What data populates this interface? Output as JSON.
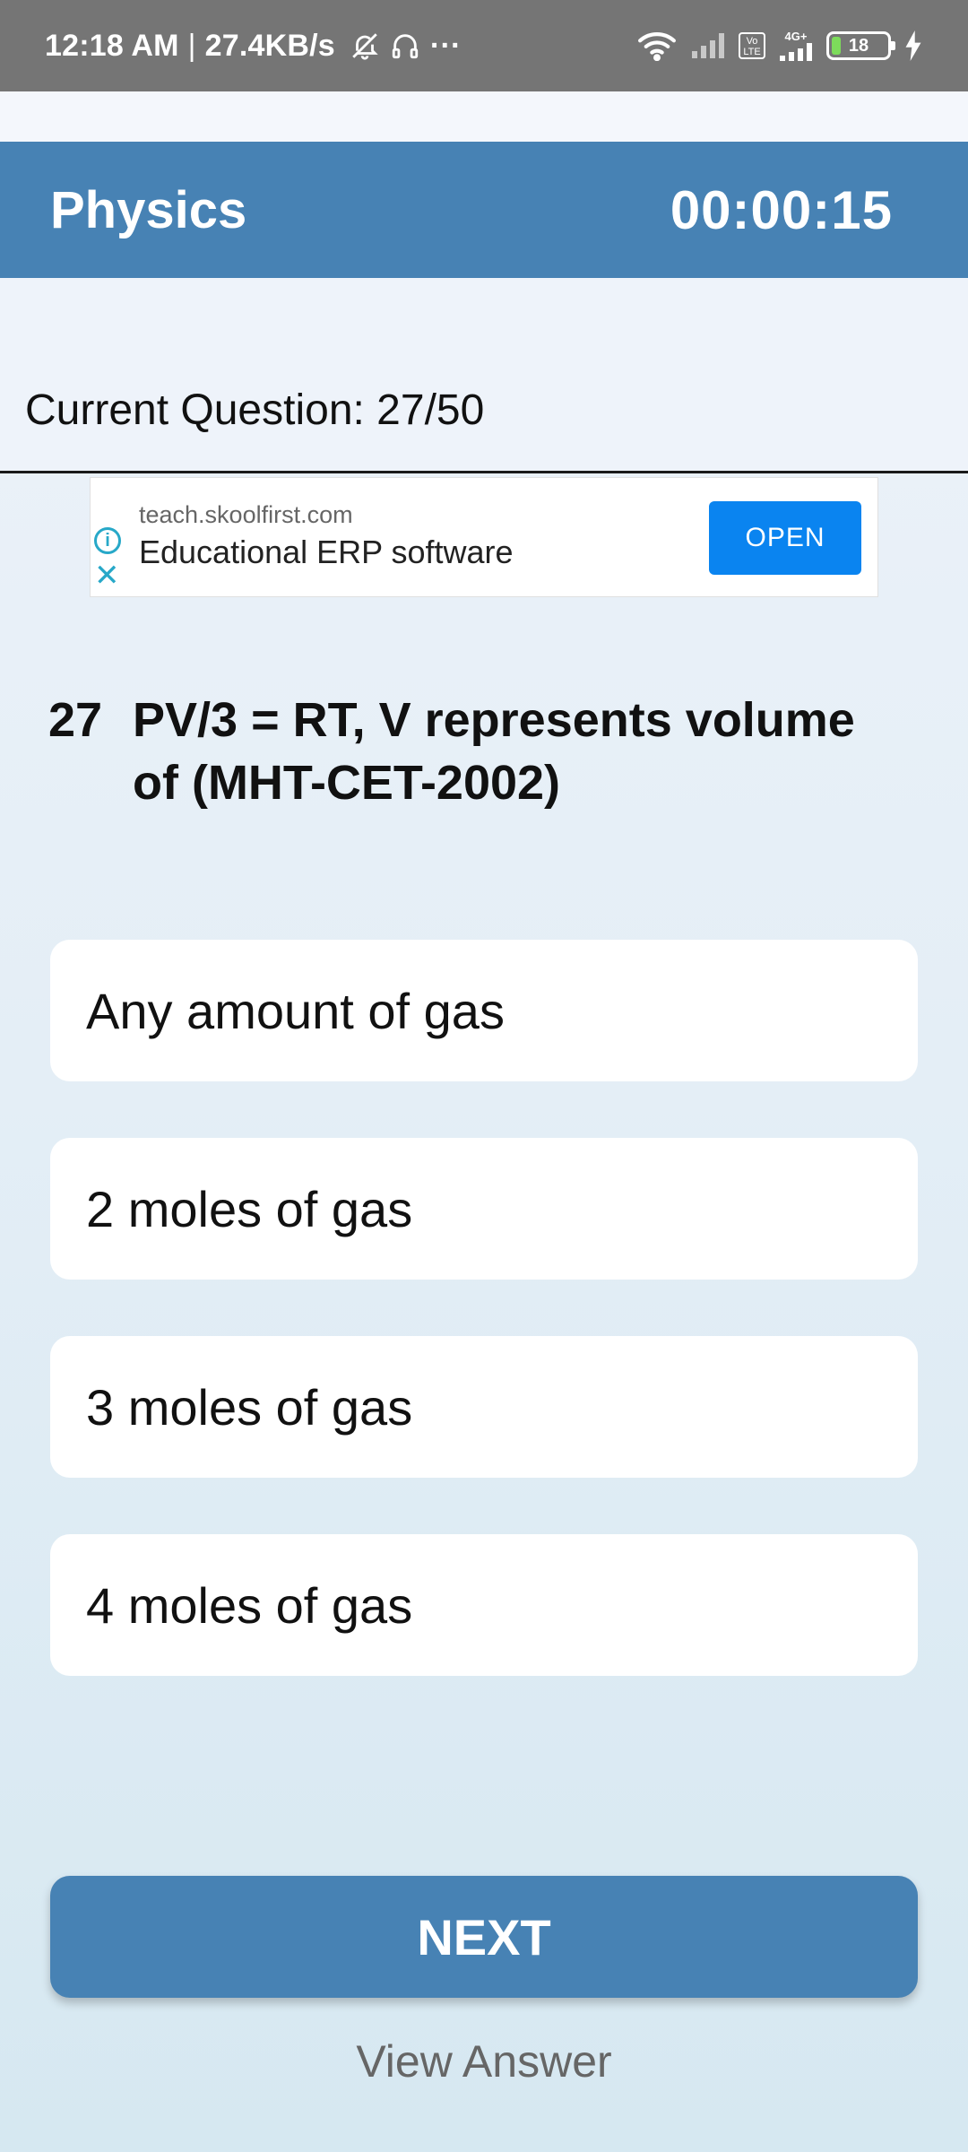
{
  "status_bar": {
    "time": "12:18 AM",
    "separator": "|",
    "speed": "27.4KB/s",
    "more": "···",
    "volte_label": "Vo LTE",
    "net_type": "4G+",
    "battery": "18",
    "icons": [
      "mute-bell-icon",
      "headphones-icon",
      "wifi-icon",
      "signal-icon",
      "charging-icon"
    ]
  },
  "header": {
    "title": "Physics",
    "timer": "00:00:15",
    "color": "#4782b4"
  },
  "progress": {
    "label": "Current Question: 27/50"
  },
  "ad": {
    "domain": "teach.skoolfirst.com",
    "title": "Educational ERP software",
    "button": "OPEN",
    "info_glyph": "i",
    "close_glyph": "✕",
    "button_color": "#0a84f0"
  },
  "question": {
    "number": "27",
    "text": "PV/3 = RT, V represents volume of (MHT-CET-2002)"
  },
  "options": [
    "Any amount of gas",
    "2 moles of gas",
    "3 moles of gas",
    "4 moles of gas"
  ],
  "actions": {
    "next": "NEXT",
    "view_answer": "View Answer"
  }
}
